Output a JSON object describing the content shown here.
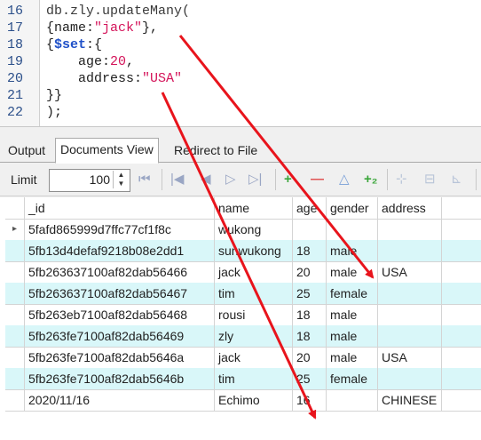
{
  "editor": {
    "lines": [
      {
        "num": "16",
        "parts": [
          {
            "t": "db.zly.updateMany(",
            "c": "obj"
          }
        ]
      },
      {
        "num": "17",
        "parts": [
          {
            "t": "{name:",
            "c": "br"
          },
          {
            "t": "\"jack\"",
            "c": "str"
          },
          {
            "t": "},",
            "c": "br"
          }
        ]
      },
      {
        "num": "18",
        "parts": [
          {
            "t": "{",
            "c": "br"
          },
          {
            "t": "$set",
            "c": "kw"
          },
          {
            "t": ":{",
            "c": "br"
          }
        ]
      },
      {
        "num": "19",
        "parts": [
          {
            "t": "    age:",
            "c": "br"
          },
          {
            "t": "20",
            "c": "num"
          },
          {
            "t": ",",
            "c": "br"
          }
        ]
      },
      {
        "num": "20",
        "parts": [
          {
            "t": "    address:",
            "c": "br"
          },
          {
            "t": "\"USA\"",
            "c": "str"
          }
        ]
      },
      {
        "num": "21",
        "parts": [
          {
            "t": "}}",
            "c": "br"
          }
        ]
      },
      {
        "num": "22",
        "parts": [
          {
            "t": ");",
            "c": "br"
          }
        ]
      }
    ]
  },
  "tabs": [
    {
      "label": "Output",
      "active": false
    },
    {
      "label": "Documents View",
      "active": true
    },
    {
      "label": "Redirect to File",
      "active": false
    }
  ],
  "toolbar": {
    "limit_label": "Limit",
    "limit_value": "100",
    "icons": [
      "first-page-icon",
      "prev-page-icon",
      "prev-icon",
      "next-icon",
      "last-page-icon",
      "add-icon",
      "remove-icon",
      "up-icon",
      "add-field-icon",
      "insert-icon",
      "delete-icon",
      "collapse-icon"
    ]
  },
  "grid": {
    "columns": [
      "",
      "_id",
      "name",
      "age",
      "gender",
      "address",
      ""
    ],
    "rows": [
      {
        "marker": "▸",
        "id": "5fafd865999d7ffc77cf1f8c",
        "name": "wukong",
        "age": "",
        "gender": "",
        "address": ""
      },
      {
        "marker": "",
        "id": "5fb13d4defaf9218b08e2dd1",
        "name": "sunwukong",
        "age": "18",
        "gender": "male",
        "address": ""
      },
      {
        "marker": "",
        "id": "5fb263637100af82dab56466",
        "name": "jack",
        "age": "20",
        "gender": "male",
        "address": "USA"
      },
      {
        "marker": "",
        "id": "5fb263637100af82dab56467",
        "name": "tim",
        "age": "25",
        "gender": "female",
        "address": ""
      },
      {
        "marker": "",
        "id": "5fb263eb7100af82dab56468",
        "name": "rousi",
        "age": "18",
        "gender": "male",
        "address": ""
      },
      {
        "marker": "",
        "id": "5fb263fe7100af82dab56469",
        "name": "zly",
        "age": "18",
        "gender": "male",
        "address": ""
      },
      {
        "marker": "",
        "id": "5fb263fe7100af82dab5646a",
        "name": "jack",
        "age": "20",
        "gender": "male",
        "address": "USA"
      },
      {
        "marker": "",
        "id": "5fb263fe7100af82dab5646b",
        "name": "tim",
        "age": "25",
        "gender": "female",
        "address": ""
      },
      {
        "marker": "",
        "id": "2020/11/16",
        "name": "Echimo",
        "age": "16",
        "gender": "",
        "address": "CHINESE"
      }
    ]
  },
  "colors": {
    "arrow": "#e8141c",
    "row_alt": "#d9f7f9"
  }
}
